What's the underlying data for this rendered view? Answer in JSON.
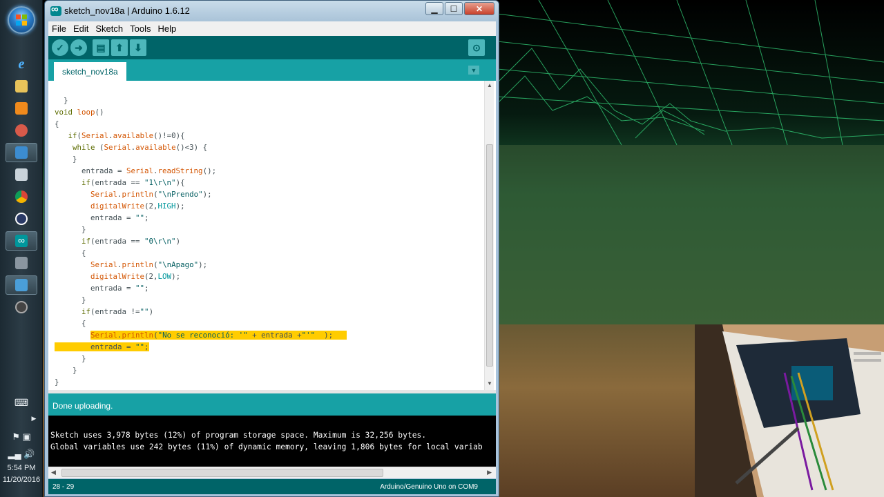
{
  "window": {
    "title": "sketch_nov18a | Arduino 1.6.12",
    "minimize": "▁",
    "maximize": "☐",
    "close": "✕"
  },
  "menu": [
    "File",
    "Edit",
    "Sketch",
    "Tools",
    "Help"
  ],
  "toolbar": {
    "verify_icon": "check-icon",
    "upload_icon": "arrow-right-icon",
    "new_icon": "new-file-icon",
    "open_icon": "arrow-up-icon",
    "save_icon": "arrow-down-icon",
    "serial_monitor_icon": "magnifier-icon"
  },
  "tab": {
    "label": "sketch_nov18a"
  },
  "code": {
    "lines": [
      "  }",
      "void loop()",
      "{",
      "   if(Serial.available()!=0){",
      "    while (Serial.available()<3) {",
      "    }",
      "      entrada = Serial.readString();",
      "      if(entrada == \"1\\r\\n\"){",
      "        Serial.println(\"\\nPrendo\");",
      "        digitalWrite(2,HIGH);",
      "        entrada = \"\";",
      "      }",
      "      if(entrada == \"0\\r\\n\")",
      "      {",
      "        Serial.println(\"\\nApago\");",
      "        digitalWrite(2,LOW);",
      "        entrada = \"\";",
      "      }",
      "      if(entrada !=\"\")",
      "      {",
      "        Serial.println(\"No se reconoció: '\" + entrada +\"'\"  );",
      "        entrada = \"\";",
      "      }",
      "    }",
      "}"
    ]
  },
  "status": {
    "message": "Done uploading."
  },
  "console": {
    "lines": [
      "Sketch uses 3,978 bytes (12%) of program storage space. Maximum is 32,256 bytes.",
      "Global variables use 242 bytes (11%) of dynamic memory, leaving 1,806 bytes for local variab"
    ]
  },
  "footer": {
    "cursor": "28 - 29",
    "board": "Arduino/Genuino Uno on COM9"
  },
  "taskbar": {
    "time": "5:54 PM",
    "date": "11/20/2016"
  },
  "colors": {
    "arduino_dark": "#006468",
    "arduino_teal": "#17a1a5",
    "highlight": "#ffcc00"
  }
}
